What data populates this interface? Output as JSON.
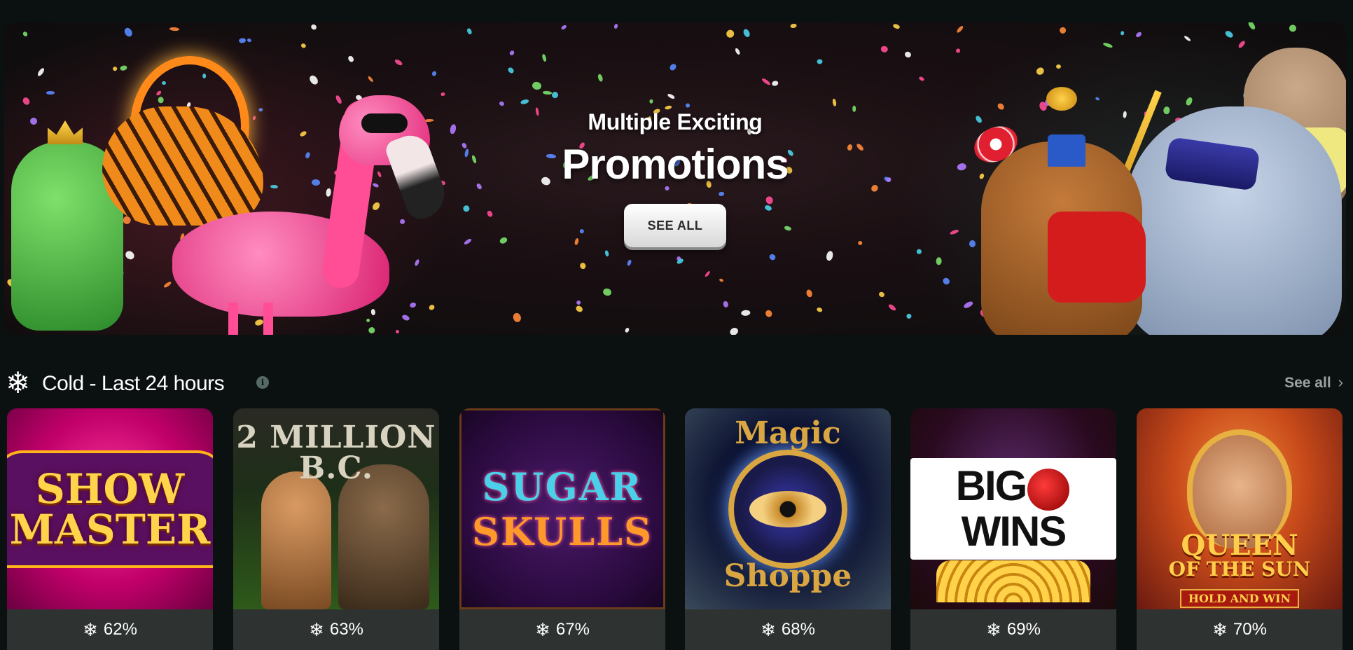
{
  "banner": {
    "subtitle": "Multiple Exciting",
    "title": "Promotions",
    "button_label": "SEE ALL"
  },
  "section": {
    "icon": "snowflake-icon",
    "title": "Cold - Last 24 hours",
    "see_all_label": "See all"
  },
  "games": [
    {
      "title_line1": "SHOW",
      "title_line2": "MASTER",
      "percent": "62%"
    },
    {
      "title_line1": "2 MILLION B.C.",
      "percent": "63%"
    },
    {
      "title_line1": "SUGAR",
      "title_line2": "SKULLS",
      "percent": "67%"
    },
    {
      "title_line1": "Magic",
      "title_line2": "Shoppe",
      "percent": "68%"
    },
    {
      "title_line1": "BIG",
      "title_line2": "WINS",
      "percent": "69%"
    },
    {
      "title_line1": "QUEEN",
      "title_line2": "OF THE SUN",
      "subtitle": "HOLD AND WIN",
      "percent": "70%"
    }
  ],
  "colors": {
    "background": "#0b1110",
    "card_footer": "#2e3331",
    "see_all_link": "#9aa39f"
  }
}
